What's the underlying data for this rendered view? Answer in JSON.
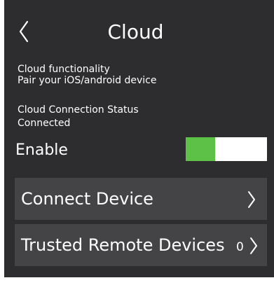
{
  "header": {
    "title": "Cloud",
    "back_icon": "chevron-left-icon"
  },
  "info": {
    "functionality_title": "Cloud functionality",
    "functionality_subtitle": "Pair your iOS/android device",
    "status_title": "Cloud Connection Status",
    "status_value": "Connected"
  },
  "enable": {
    "label": "Enable",
    "toggle_on": true
  },
  "menu": {
    "connect_device": {
      "label": "Connect Device",
      "icon": "chevron-right-icon"
    },
    "trusted_devices": {
      "label": "Trusted Remote Devices",
      "count": "0",
      "icon": "chevron-right-icon"
    }
  },
  "colors": {
    "background": "#2d2d2f",
    "row_background": "#444446",
    "toggle_on": "#5cc146",
    "toggle_track": "#ffffff",
    "text": "#ffffff"
  }
}
